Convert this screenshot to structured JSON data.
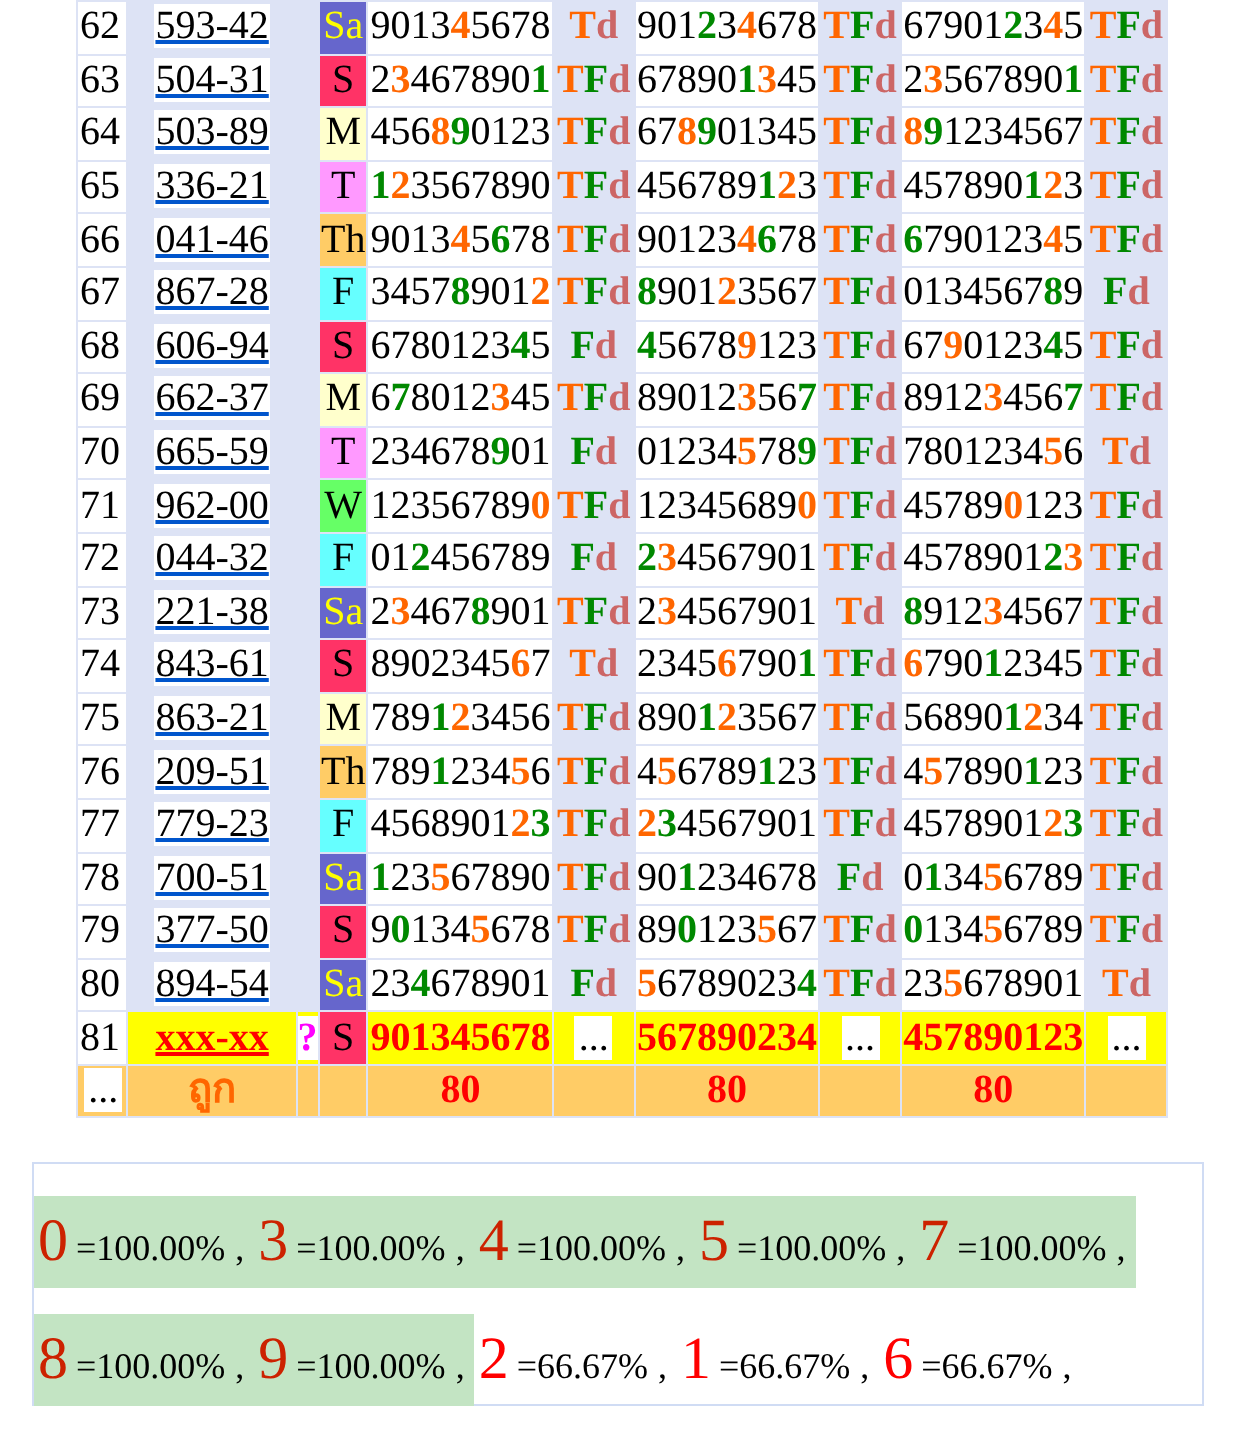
{
  "rows": [
    {
      "kind": "draw",
      "no": "62",
      "code": "593-42",
      "day": {
        "label": "Sa",
        "kind": "dark",
        "color": "#6666cc"
      },
      "draws": [
        {
          "parts": [
            {
              "text": "9013"
            },
            {
              "text": "4",
              "color": "#ff6600"
            },
            {
              "text": "5678"
            }
          ],
          "result": "Td"
        },
        {
          "parts": [
            {
              "text": "901"
            },
            {
              "text": "2",
              "color": "#008800"
            },
            {
              "text": "3"
            },
            {
              "text": "4",
              "color": "#ff6600"
            },
            {
              "text": "678"
            }
          ],
          "result": "TFd"
        },
        {
          "parts": [
            {
              "text": "67901"
            },
            {
              "text": "2",
              "color": "#008800"
            },
            {
              "text": "3"
            },
            {
              "text": "4",
              "color": "#ff6600"
            },
            {
              "text": "5"
            }
          ],
          "result": "TFd"
        }
      ]
    },
    {
      "kind": "draw",
      "no": "63",
      "code": "504-31",
      "day": {
        "label": "S",
        "kind": "light",
        "color": "#ff3366"
      },
      "draws": [
        {
          "parts": [
            {
              "text": "2"
            },
            {
              "text": "3",
              "color": "#ff6600"
            },
            {
              "text": "467890"
            },
            {
              "text": "1",
              "color": "#008800"
            }
          ],
          "result": "TFd"
        },
        {
          "parts": [
            {
              "text": "67890"
            },
            {
              "text": "1",
              "color": "#008800"
            },
            {
              "text": "3",
              "color": "#ff6600"
            },
            {
              "text": "45"
            }
          ],
          "result": "TFd"
        },
        {
          "parts": [
            {
              "text": "2"
            },
            {
              "text": "3",
              "color": "#ff6600"
            },
            {
              "text": "567890"
            },
            {
              "text": "1",
              "color": "#008800"
            }
          ],
          "result": "TFd"
        }
      ]
    },
    {
      "kind": "draw",
      "no": "64",
      "code": "503-89",
      "day": {
        "label": "M",
        "kind": "light",
        "color": "#ffffcc"
      },
      "draws": [
        {
          "parts": [
            {
              "text": "456"
            },
            {
              "text": "8",
              "color": "#ff6600"
            },
            {
              "text": "9",
              "color": "#008800"
            },
            {
              "text": "0123"
            }
          ],
          "result": "TFd"
        },
        {
          "parts": [
            {
              "text": "67"
            },
            {
              "text": "8",
              "color": "#ff6600"
            },
            {
              "text": "9",
              "color": "#008800"
            },
            {
              "text": "01345"
            }
          ],
          "result": "TFd"
        },
        {
          "parts": [
            {
              "text": "8",
              "color": "#ff6600"
            },
            {
              "text": "9",
              "color": "#008800"
            },
            {
              "text": "1234567"
            }
          ],
          "result": "TFd"
        }
      ]
    },
    {
      "kind": "draw",
      "no": "65",
      "code": "336-21",
      "day": {
        "label": "T",
        "kind": "light",
        "color": "#ff99ff"
      },
      "draws": [
        {
          "parts": [
            {
              "text": "1",
              "color": "#008800"
            },
            {
              "text": "2",
              "color": "#ff6600"
            },
            {
              "text": "3567890"
            }
          ],
          "result": "TFd"
        },
        {
          "parts": [
            {
              "text": "456789"
            },
            {
              "text": "1",
              "color": "#008800"
            },
            {
              "text": "2",
              "color": "#ff6600"
            },
            {
              "text": "3"
            }
          ],
          "result": "TFd"
        },
        {
          "parts": [
            {
              "text": "457890"
            },
            {
              "text": "1",
              "color": "#008800"
            },
            {
              "text": "2",
              "color": "#ff6600"
            },
            {
              "text": "3"
            }
          ],
          "result": "TFd"
        }
      ]
    },
    {
      "kind": "draw",
      "no": "66",
      "code": "041-46",
      "day": {
        "label": "Th",
        "kind": "light",
        "color": "#ffcc66"
      },
      "draws": [
        {
          "parts": [
            {
              "text": "9013"
            },
            {
              "text": "4",
              "color": "#ff6600"
            },
            {
              "text": "5"
            },
            {
              "text": "6",
              "color": "#008800"
            },
            {
              "text": "78"
            }
          ],
          "result": "TFd"
        },
        {
          "parts": [
            {
              "text": "90123"
            },
            {
              "text": "4",
              "color": "#ff6600"
            },
            {
              "text": "6",
              "color": "#008800"
            },
            {
              "text": "78"
            }
          ],
          "result": "TFd"
        },
        {
          "parts": [
            {
              "text": "6",
              "color": "#008800"
            },
            {
              "text": "790123"
            },
            {
              "text": "4",
              "color": "#ff6600"
            },
            {
              "text": "5"
            }
          ],
          "result": "TFd"
        }
      ]
    },
    {
      "kind": "draw",
      "no": "67",
      "code": "867-28",
      "day": {
        "label": "F",
        "kind": "light",
        "color": "#66ffff"
      },
      "draws": [
        {
          "parts": [
            {
              "text": "3457"
            },
            {
              "text": "8",
              "color": "#008800"
            },
            {
              "text": "901"
            },
            {
              "text": "2",
              "color": "#ff6600"
            }
          ],
          "result": "TFd"
        },
        {
          "parts": [
            {
              "text": "8",
              "color": "#008800"
            },
            {
              "text": "901"
            },
            {
              "text": "2",
              "color": "#ff6600"
            },
            {
              "text": "3567"
            }
          ],
          "result": "TFd"
        },
        {
          "parts": [
            {
              "text": "0134567"
            },
            {
              "text": "8",
              "color": "#008800"
            },
            {
              "text": "9"
            }
          ],
          "result": "Fd"
        }
      ]
    },
    {
      "kind": "draw",
      "no": "68",
      "code": "606-94",
      "day": {
        "label": "S",
        "kind": "light",
        "color": "#ff3366"
      },
      "draws": [
        {
          "parts": [
            {
              "text": "6780123"
            },
            {
              "text": "4",
              "color": "#008800"
            },
            {
              "text": "5"
            }
          ],
          "result": "Fd"
        },
        {
          "parts": [
            {
              "text": "4",
              "color": "#008800"
            },
            {
              "text": "5678"
            },
            {
              "text": "9",
              "color": "#ff6600"
            },
            {
              "text": "123"
            }
          ],
          "result": "TFd"
        },
        {
          "parts": [
            {
              "text": "67"
            },
            {
              "text": "9",
              "color": "#ff6600"
            },
            {
              "text": "0123"
            },
            {
              "text": "4",
              "color": "#008800"
            },
            {
              "text": "5"
            }
          ],
          "result": "TFd"
        }
      ]
    },
    {
      "kind": "draw",
      "no": "69",
      "code": "662-37",
      "day": {
        "label": "M",
        "kind": "light",
        "color": "#ffffcc"
      },
      "draws": [
        {
          "parts": [
            {
              "text": "6"
            },
            {
              "text": "7",
              "color": "#008800"
            },
            {
              "text": "8012"
            },
            {
              "text": "3",
              "color": "#ff6600"
            },
            {
              "text": "45"
            }
          ],
          "result": "TFd"
        },
        {
          "parts": [
            {
              "text": "89012"
            },
            {
              "text": "3",
              "color": "#ff6600"
            },
            {
              "text": "56"
            },
            {
              "text": "7",
              "color": "#008800"
            }
          ],
          "result": "TFd"
        },
        {
          "parts": [
            {
              "text": "8912"
            },
            {
              "text": "3",
              "color": "#ff6600"
            },
            {
              "text": "456"
            },
            {
              "text": "7",
              "color": "#008800"
            }
          ],
          "result": "TFd"
        }
      ]
    },
    {
      "kind": "draw",
      "no": "70",
      "code": "665-59",
      "day": {
        "label": "T",
        "kind": "light",
        "color": "#ff99ff"
      },
      "draws": [
        {
          "parts": [
            {
              "text": "234678"
            },
            {
              "text": "9",
              "color": "#008800"
            },
            {
              "text": "01"
            }
          ],
          "result": "Fd"
        },
        {
          "parts": [
            {
              "text": "01234"
            },
            {
              "text": "5",
              "color": "#ff6600"
            },
            {
              "text": "78"
            },
            {
              "text": "9",
              "color": "#008800"
            }
          ],
          "result": "TFd"
        },
        {
          "parts": [
            {
              "text": "7801234"
            },
            {
              "text": "5",
              "color": "#ff6600"
            },
            {
              "text": "6"
            }
          ],
          "result": "Td"
        }
      ]
    },
    {
      "kind": "draw",
      "no": "71",
      "code": "962-00",
      "day": {
        "label": "W",
        "kind": "light",
        "color": "#66ff66"
      },
      "draws": [
        {
          "parts": [
            {
              "text": "12356789"
            },
            {
              "text": "0",
              "color": "#ff6600"
            }
          ],
          "result": "TFd"
        },
        {
          "parts": [
            {
              "text": "12345689"
            },
            {
              "text": "0",
              "color": "#ff6600"
            }
          ],
          "result": "TFd"
        },
        {
          "parts": [
            {
              "text": "45789"
            },
            {
              "text": "0",
              "color": "#ff6600"
            },
            {
              "text": "123"
            }
          ],
          "result": "TFd"
        }
      ]
    },
    {
      "kind": "draw",
      "no": "72",
      "code": "044-32",
      "day": {
        "label": "F",
        "kind": "light",
        "color": "#66ffff"
      },
      "draws": [
        {
          "parts": [
            {
              "text": "01"
            },
            {
              "text": "2",
              "color": "#008800"
            },
            {
              "text": "456789"
            }
          ],
          "result": "Fd"
        },
        {
          "parts": [
            {
              "text": "2",
              "color": "#008800"
            },
            {
              "text": "3",
              "color": "#ff6600"
            },
            {
              "text": "4567901"
            }
          ],
          "result": "TFd"
        },
        {
          "parts": [
            {
              "text": "4578901"
            },
            {
              "text": "2",
              "color": "#008800"
            },
            {
              "text": "3",
              "color": "#ff6600"
            }
          ],
          "result": "TFd"
        }
      ]
    },
    {
      "kind": "draw",
      "no": "73",
      "code": "221-38",
      "day": {
        "label": "Sa",
        "kind": "dark",
        "color": "#6666cc"
      },
      "draws": [
        {
          "parts": [
            {
              "text": "2"
            },
            {
              "text": "3",
              "color": "#ff6600"
            },
            {
              "text": "467"
            },
            {
              "text": "8",
              "color": "#008800"
            },
            {
              "text": "901"
            }
          ],
          "result": "TFd"
        },
        {
          "parts": [
            {
              "text": "2"
            },
            {
              "text": "3",
              "color": "#ff6600"
            },
            {
              "text": "4567901"
            }
          ],
          "result": "Td"
        },
        {
          "parts": [
            {
              "text": "8",
              "color": "#008800"
            },
            {
              "text": "912"
            },
            {
              "text": "3",
              "color": "#ff6600"
            },
            {
              "text": "4567"
            }
          ],
          "result": "TFd"
        }
      ]
    },
    {
      "kind": "draw",
      "no": "74",
      "code": "843-61",
      "day": {
        "label": "S",
        "kind": "light",
        "color": "#ff3366"
      },
      "draws": [
        {
          "parts": [
            {
              "text": "8902345"
            },
            {
              "text": "6",
              "color": "#ff6600"
            },
            {
              "text": "7"
            }
          ],
          "result": "Td"
        },
        {
          "parts": [
            {
              "text": "2345"
            },
            {
              "text": "6",
              "color": "#ff6600"
            },
            {
              "text": "790"
            },
            {
              "text": "1",
              "color": "#008800"
            }
          ],
          "result": "TFd"
        },
        {
          "parts": [
            {
              "text": "6",
              "color": "#ff6600"
            },
            {
              "text": "790"
            },
            {
              "text": "1",
              "color": "#008800"
            },
            {
              "text": "2345"
            }
          ],
          "result": "TFd"
        }
      ]
    },
    {
      "kind": "draw",
      "no": "75",
      "code": "863-21",
      "day": {
        "label": "M",
        "kind": "light",
        "color": "#ffffcc"
      },
      "draws": [
        {
          "parts": [
            {
              "text": "789"
            },
            {
              "text": "1",
              "color": "#008800"
            },
            {
              "text": "2",
              "color": "#ff6600"
            },
            {
              "text": "3456"
            }
          ],
          "result": "TFd"
        },
        {
          "parts": [
            {
              "text": "890"
            },
            {
              "text": "1",
              "color": "#008800"
            },
            {
              "text": "2",
              "color": "#ff6600"
            },
            {
              "text": "3567"
            }
          ],
          "result": "TFd"
        },
        {
          "parts": [
            {
              "text": "56890"
            },
            {
              "text": "1",
              "color": "#008800"
            },
            {
              "text": "2",
              "color": "#ff6600"
            },
            {
              "text": "34"
            }
          ],
          "result": "TFd"
        }
      ]
    },
    {
      "kind": "draw",
      "no": "76",
      "code": "209-51",
      "day": {
        "label": "Th",
        "kind": "light",
        "color": "#ffcc66"
      },
      "draws": [
        {
          "parts": [
            {
              "text": "789"
            },
            {
              "text": "1",
              "color": "#008800"
            },
            {
              "text": "234"
            },
            {
              "text": "5",
              "color": "#ff6600"
            },
            {
              "text": "6"
            }
          ],
          "result": "TFd"
        },
        {
          "parts": [
            {
              "text": "4"
            },
            {
              "text": "5",
              "color": "#ff6600"
            },
            {
              "text": "6789"
            },
            {
              "text": "1",
              "color": "#008800"
            },
            {
              "text": "23"
            }
          ],
          "result": "TFd"
        },
        {
          "parts": [
            {
              "text": "4"
            },
            {
              "text": "5",
              "color": "#ff6600"
            },
            {
              "text": "7890"
            },
            {
              "text": "1",
              "color": "#008800"
            },
            {
              "text": "23"
            }
          ],
          "result": "TFd"
        }
      ]
    },
    {
      "kind": "draw",
      "no": "77",
      "code": "779-23",
      "day": {
        "label": "F",
        "kind": "light",
        "color": "#66ffff"
      },
      "draws": [
        {
          "parts": [
            {
              "text": "4568901"
            },
            {
              "text": "2",
              "color": "#ff6600"
            },
            {
              "text": "3",
              "color": "#008800"
            }
          ],
          "result": "TFd"
        },
        {
          "parts": [
            {
              "text": "2",
              "color": "#ff6600"
            },
            {
              "text": "3",
              "color": "#008800"
            },
            {
              "text": "4567901"
            }
          ],
          "result": "TFd"
        },
        {
          "parts": [
            {
              "text": "4578901"
            },
            {
              "text": "2",
              "color": "#ff6600"
            },
            {
              "text": "3",
              "color": "#008800"
            }
          ],
          "result": "TFd"
        }
      ]
    },
    {
      "kind": "draw",
      "no": "78",
      "code": "700-51",
      "day": {
        "label": "Sa",
        "kind": "dark",
        "color": "#6666cc"
      },
      "draws": [
        {
          "parts": [
            {
              "text": "1",
              "color": "#008800"
            },
            {
              "text": "23"
            },
            {
              "text": "5",
              "color": "#ff6600"
            },
            {
              "text": "67890"
            }
          ],
          "result": "TFd"
        },
        {
          "parts": [
            {
              "text": "90"
            },
            {
              "text": "1",
              "color": "#008800"
            },
            {
              "text": "234678"
            }
          ],
          "result": "Fd"
        },
        {
          "parts": [
            {
              "text": "0"
            },
            {
              "text": "1",
              "color": "#008800"
            },
            {
              "text": "34"
            },
            {
              "text": "5",
              "color": "#ff6600"
            },
            {
              "text": "6789"
            }
          ],
          "result": "TFd"
        }
      ]
    },
    {
      "kind": "draw",
      "no": "79",
      "code": "377-50",
      "day": {
        "label": "S",
        "kind": "light",
        "color": "#ff3366"
      },
      "draws": [
        {
          "parts": [
            {
              "text": "9"
            },
            {
              "text": "0",
              "color": "#008800"
            },
            {
              "text": "134"
            },
            {
              "text": "5",
              "color": "#ff6600"
            },
            {
              "text": "678"
            }
          ],
          "result": "TFd"
        },
        {
          "parts": [
            {
              "text": "89"
            },
            {
              "text": "0",
              "color": "#008800"
            },
            {
              "text": "123"
            },
            {
              "text": "5",
              "color": "#ff6600"
            },
            {
              "text": "67"
            }
          ],
          "result": "TFd"
        },
        {
          "parts": [
            {
              "text": "0",
              "color": "#008800"
            },
            {
              "text": "134"
            },
            {
              "text": "5",
              "color": "#ff6600"
            },
            {
              "text": "6789"
            }
          ],
          "result": "TFd"
        }
      ]
    },
    {
      "kind": "draw",
      "no": "80",
      "code": "894-54",
      "day": {
        "label": "Sa",
        "kind": "dark",
        "color": "#6666cc"
      },
      "draws": [
        {
          "parts": [
            {
              "text": "23"
            },
            {
              "text": "4",
              "color": "#008800"
            },
            {
              "text": "678901"
            }
          ],
          "result": "Fd"
        },
        {
          "parts": [
            {
              "text": "5",
              "color": "#ff6600"
            },
            {
              "text": "6789023"
            },
            {
              "text": "4",
              "color": "#008800"
            }
          ],
          "result": "TFd"
        },
        {
          "parts": [
            {
              "text": "23"
            },
            {
              "text": "5",
              "color": "#ff6600"
            },
            {
              "text": "678901"
            }
          ],
          "result": "Td"
        }
      ]
    },
    {
      "kind": "pending",
      "no": "81",
      "code": "xxx-xx",
      "flag": "?",
      "day": {
        "label": "S",
        "kind": "light",
        "color": "#ff3366"
      },
      "draws": [
        {
          "parts": [
            {
              "text": "901345678"
            }
          ],
          "result": "..."
        },
        {
          "parts": [
            {
              "text": "567890234"
            }
          ],
          "result": "..."
        },
        {
          "parts": [
            {
              "text": "457890123"
            }
          ],
          "result": "..."
        }
      ]
    }
  ],
  "footer": {
    "no": "...",
    "label": "ถูก",
    "counts": [
      "80",
      "80",
      "80"
    ]
  },
  "stats": [
    {
      "digit": "0",
      "percent": "=100.00%",
      "sep": ",",
      "highlight": true
    },
    {
      "digit": "3",
      "percent": "=100.00%",
      "sep": ",",
      "highlight": true
    },
    {
      "digit": "4",
      "percent": "=100.00%",
      "sep": ",",
      "highlight": true
    },
    {
      "digit": "5",
      "percent": "=100.00%",
      "sep": ",",
      "highlight": true
    },
    {
      "digit": "7",
      "percent": "=100.00%",
      "sep": ",",
      "highlight": true
    },
    {
      "digit": "8",
      "percent": "=100.00%",
      "sep": ",",
      "highlight": true
    },
    {
      "digit": "9",
      "percent": "=100.00%",
      "sep": ",",
      "highlight": true
    },
    {
      "digit": "2",
      "percent": "=66.67%",
      "sep": ",",
      "highlight": false
    },
    {
      "digit": "1",
      "percent": "=66.67%",
      "sep": ",",
      "highlight": false
    },
    {
      "digit": "6",
      "percent": "=66.67%",
      "sep": ",",
      "highlight": false
    }
  ]
}
